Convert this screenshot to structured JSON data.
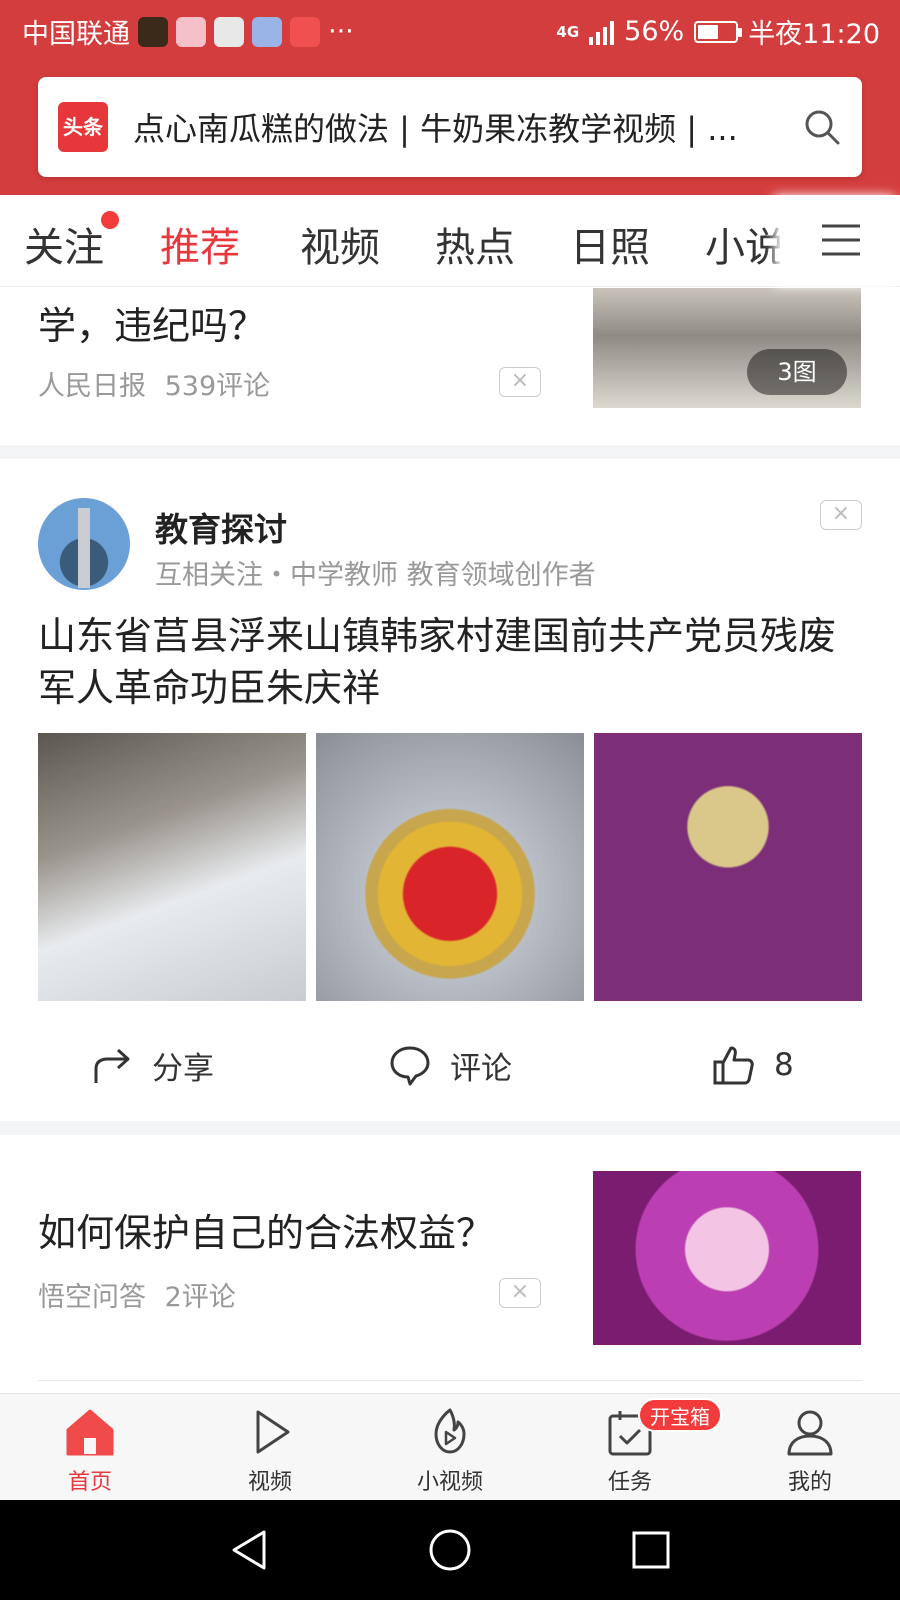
{
  "status_bar": {
    "carrier": "中国联通",
    "more": "···",
    "network": "4G",
    "battery": "56%",
    "battery_level": 0.56,
    "time": "半夜11:20"
  },
  "search": {
    "logo_text": "头条",
    "query": "点心南瓜糕的做法 | 牛奶果冻教学视频 | ..."
  },
  "tabs": [
    "关注",
    "推荐",
    "视频",
    "热点",
    "日照",
    "小说"
  ],
  "active_tab": "推荐",
  "feed": {
    "item1": {
      "title_partial": "学，违纪吗？",
      "source": "人民日报",
      "comments": "539评论",
      "image_count": "3图"
    },
    "item2": {
      "author": "教育探讨",
      "author_desc": "互相关注・中学教师 教育领域创作者",
      "title": "山东省莒县浮来山镇韩家村建国前共产党员残废军人革命功臣朱庆祥",
      "share_label": "分享",
      "comment_label": "评论",
      "likes": "8"
    },
    "item3": {
      "title": "如何保护自己的合法权益？",
      "source": "悟空问答",
      "comments": "2评论"
    },
    "close_symbol": "×"
  },
  "bottom_nav": {
    "items": [
      "首页",
      "视频",
      "小视频",
      "任务",
      "我的"
    ],
    "task_badge": "开宝箱"
  },
  "colors": {
    "brand_red": "#d43d3d",
    "active_red": "#e8383d"
  }
}
